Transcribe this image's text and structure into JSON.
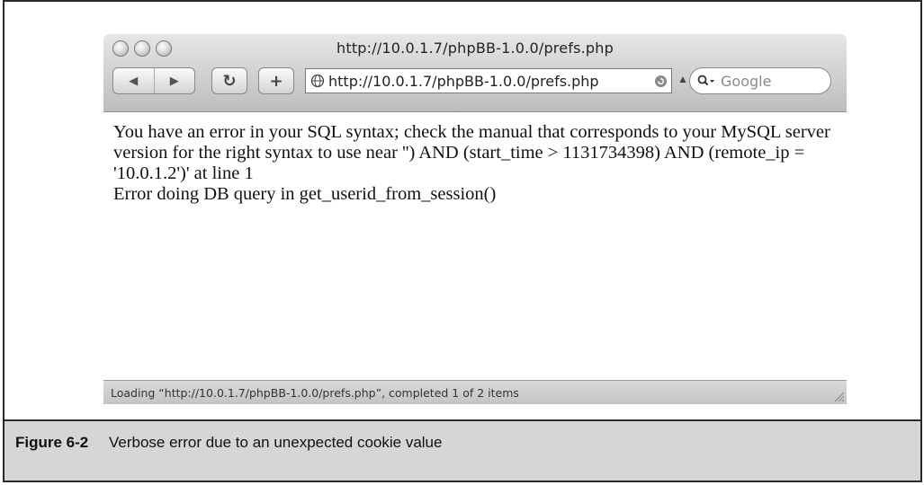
{
  "browser": {
    "window_title": "http://10.0.1.7/phpBB-1.0.0/prefs.php",
    "nav": {
      "back_glyph": "◀",
      "forward_glyph": "▶"
    },
    "reload_glyph": "↻",
    "add_glyph": "+",
    "address": {
      "url": "http://10.0.1.7/phpBB-1.0.0/prefs.php"
    },
    "search": {
      "placeholder": "Google"
    },
    "content": {
      "error_line": "You have an error in your SQL syntax; check the manual that corresponds to your MySQL server version for the right syntax to use near '') AND (start_time > 1131734398) AND (remote_ip = '10.0.1.2')' at line 1",
      "db_error_line": "Error doing DB query in get_userid_from_session()"
    },
    "status_text": "Loading “http://10.0.1.7/phpBB-1.0.0/prefs.php”, completed 1 of 2 items"
  },
  "caption": {
    "number": "Figure 6-2",
    "text": "Verbose error due to an unexpected cookie value"
  },
  "colors": {
    "caption_background": "#d6d6d6",
    "frame_border": "#2a2a2a"
  }
}
